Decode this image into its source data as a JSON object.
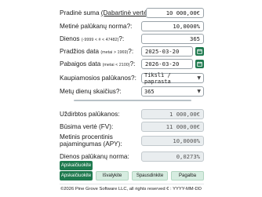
{
  "inputs": {
    "principal": {
      "label_a": "Pradinė suma ",
      "label_b": "(Dabartinė vertė)",
      "label_c": "?:",
      "value": "10 000,00€"
    },
    "nominal_rate": {
      "label": "Metinė palūkanų norma?:",
      "value": "10,0000%"
    },
    "days": {
      "label": "Dienos ",
      "hint": "(-9999 < # < 47482)",
      "label_end": "?:",
      "value": "365"
    },
    "start_date": {
      "label": "Pradžios data ",
      "hint": "(metai > 1969)",
      "label_end": "?:",
      "value": "2025-03-20"
    },
    "end_date": {
      "label": "Pabaigos data ",
      "hint": "(metai < 2100)",
      "label_end": "?:",
      "value": "2026-03-20"
    },
    "compounding": {
      "label": "Kaupiamosios palūkanos?:",
      "value": "Tikslì / paprasta"
    },
    "day_count": {
      "label": "Metų dienų skaičius?:",
      "value": "365"
    }
  },
  "results": {
    "interest_earned": {
      "label": "Uždirbtos palūkanos:",
      "value": "1 000,00€"
    },
    "future_value": {
      "label": "Būsima vertė (FV):",
      "value": "11 000,00€"
    },
    "apy": {
      "label_1": "Metinis procentinis",
      "label_2": "pajamingumas (APY):",
      "value": "10,0000%"
    },
    "daily_rate": {
      "label": "Dienos palūkanų norma:",
      "value": "0,0273%"
    }
  },
  "buttons": {
    "calculate": "Apskaičiuokite",
    "calculate_bottom": "Apskaičiuokite",
    "clear": "Išvalykite",
    "print": "Spausdinkite",
    "help": "Pagalba"
  },
  "footer": "©2026 Pine Grove Software LLC, all rights reserved € : YYYY-MM-DD",
  "colors": {
    "accent": "#1f7a4f",
    "button_light": "#d6ece0",
    "readonly_bg": "#e9edef"
  },
  "icons": {
    "calendar": "calendar-icon",
    "dropdown": "chevron-down-icon"
  }
}
